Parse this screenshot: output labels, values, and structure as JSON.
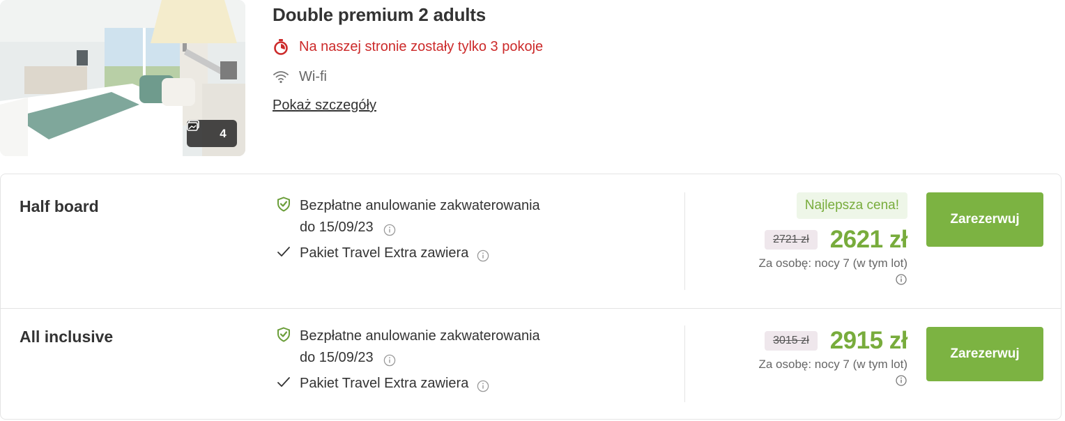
{
  "room": {
    "title": "Double premium 2 adults",
    "scarcity": "Na naszej stronie zostały tylko 3 pokoje",
    "amenity": "Wi-fi",
    "details_link": "Pokaż szczegóły",
    "photo_count": "4",
    "icons": {
      "photo": "gallery-icon",
      "scarcity": "stopwatch-icon",
      "amenity": "wifi-icon"
    }
  },
  "offers": [
    {
      "board": "Half board",
      "cancellation_line1": "Bezpłatne anulowanie zakwaterowania",
      "cancellation_date": "do 15/09/23",
      "package": "Pakiet Travel Extra zawiera",
      "badge": "Najlepsza cena!",
      "old_price": "2721 zł",
      "price": "2621 zł",
      "price_note": "Za osobę: nocy 7 (w tym lot)",
      "button": "Zarezerwuj"
    },
    {
      "board": "All inclusive",
      "cancellation_line1": "Bezpłatne anulowanie zakwaterowania",
      "cancellation_date": "do 15/09/23",
      "package": "Pakiet Travel Extra zawiera",
      "old_price": "3015 zł",
      "price": "2915 zł",
      "price_note": "Za osobę: nocy 7 (w tym lot)",
      "button": "Zarezerwuj"
    }
  ],
  "colors": {
    "accent_green": "#7cb342",
    "price_green": "#78ac3c",
    "alert_red": "#cc2a2a",
    "best_price_bg": "#eef6e8",
    "old_price_bg": "#efe7ec"
  }
}
